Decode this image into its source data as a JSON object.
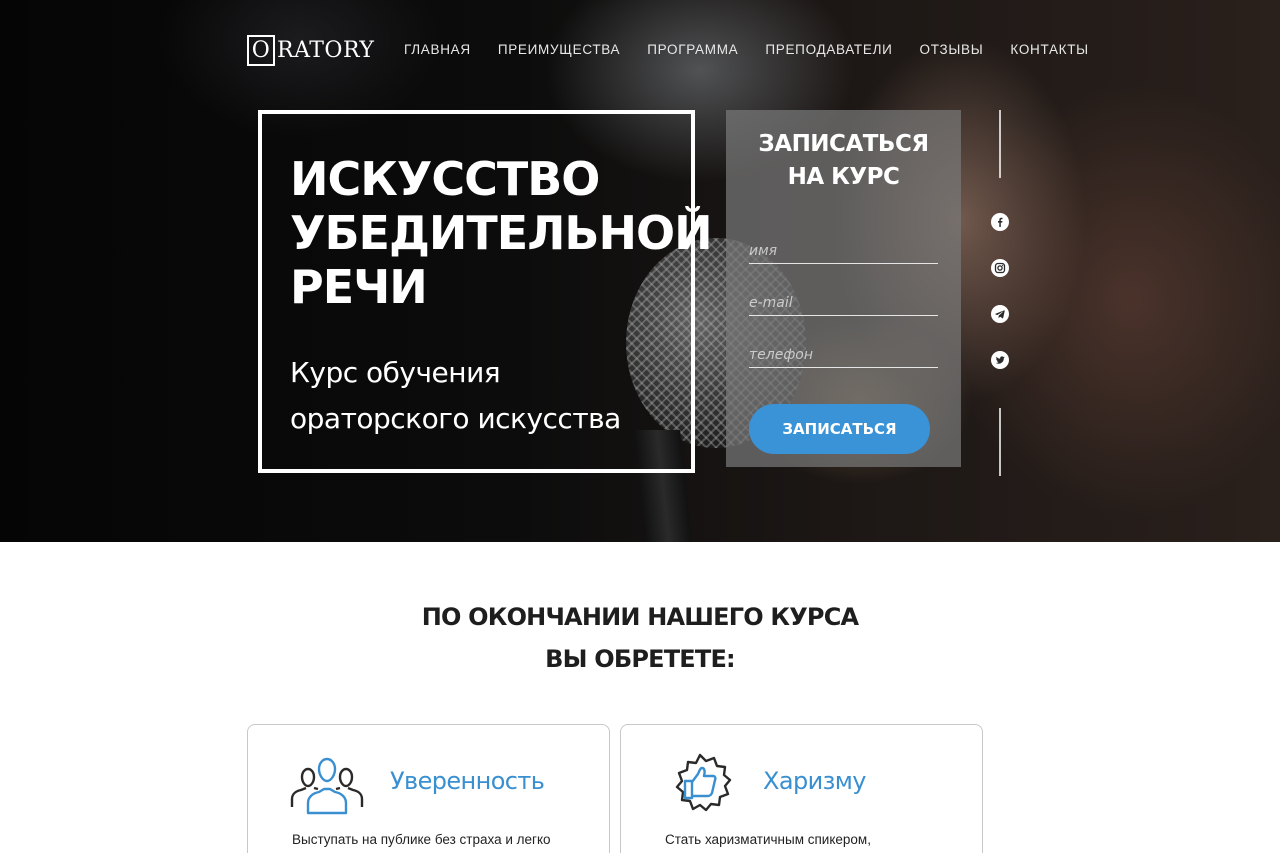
{
  "logo": {
    "first_letter": "O",
    "rest": "RATORY"
  },
  "nav": {
    "items": [
      {
        "label": "ГЛАВНАЯ"
      },
      {
        "label": "ПРЕИМУЩЕСТВА"
      },
      {
        "label": "ПРОГРАММА"
      },
      {
        "label": "ПРЕПОДАВАТЕЛИ"
      },
      {
        "label": "ОТЗЫВЫ"
      },
      {
        "label": "КОНТАКТЫ"
      }
    ]
  },
  "hero": {
    "title": "ИСКУССТВО\nУБЕДИТЕЛЬНОЙ\nРЕЧИ",
    "subtitle": "Курс обучения\nораторского искусства"
  },
  "signup": {
    "title": "ЗАПИСАТЬСЯ\nНА КУРС",
    "name_placeholder": "имя",
    "email_placeholder": "e-mail",
    "phone_placeholder": "телефон",
    "name_value": "",
    "email_value": "",
    "phone_value": "",
    "button_label": "ЗАПИСАТЬСЯ",
    "button_color": "#3a93d6"
  },
  "social": {
    "icons": [
      "facebook-icon",
      "instagram-icon",
      "telegram-icon",
      "twitter-icon"
    ]
  },
  "benefits": {
    "title": "ПО ОКОНЧАНИИ НАШЕГО КУРСА\nВЫ ОБРЕТЕТЕ:",
    "accent_color": "#3a8fd1",
    "cards": [
      {
        "icon": "people-icon",
        "heading": "Уверенность",
        "text": "Выступать на публике без страха и легко"
      },
      {
        "icon": "thumbs-up-badge-icon",
        "heading": "Харизму",
        "text": "Стать харизматичным спикером,"
      }
    ]
  }
}
